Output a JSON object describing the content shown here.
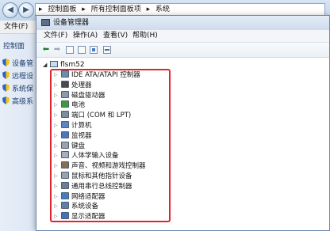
{
  "background_window": {
    "breadcrumb": [
      "控制面板",
      "所有控制面板项",
      "系统"
    ],
    "menu_file": "文件(F)",
    "left_home": "控制面",
    "left_items": [
      {
        "label": "设备管"
      },
      {
        "label": "远程设"
      },
      {
        "label": "系统保"
      },
      {
        "label": "高级系"
      }
    ]
  },
  "window": {
    "title": "设备管理器",
    "menu": {
      "file": "文件(F)",
      "action": "操作(A)",
      "view": "查看(V)",
      "help": "帮助(H)"
    }
  },
  "tree": {
    "root_name": "flsm52",
    "highlight_color": "#e0242c",
    "categories": [
      {
        "label": "IDE ATA/ATAPI 控制器",
        "icon": "ide-controller-icon",
        "color": "#6f8cab"
      },
      {
        "label": "处理器",
        "icon": "processor-icon",
        "color": "#4a4a4a"
      },
      {
        "label": "磁盘驱动器",
        "icon": "disk-drive-icon",
        "color": "#8f9aa6"
      },
      {
        "label": "电池",
        "icon": "battery-icon",
        "color": "#3d9b3a"
      },
      {
        "label": "端口 (COM 和 LPT)",
        "icon": "port-icon",
        "color": "#7f8c99"
      },
      {
        "label": "计算机",
        "icon": "computer-icon",
        "color": "#5a86c4"
      },
      {
        "label": "监视器",
        "icon": "monitor-icon",
        "color": "#4a78c0"
      },
      {
        "label": "键盘",
        "icon": "keyboard-icon",
        "color": "#9aa3ad"
      },
      {
        "label": "人体学输入设备",
        "icon": "hid-icon",
        "color": "#a8b1bb"
      },
      {
        "label": "声音、视频和游戏控制器",
        "icon": "sound-icon",
        "color": "#8a6f4f"
      },
      {
        "label": "鼠标和其他指针设备",
        "icon": "mouse-icon",
        "color": "#9aa3ad"
      },
      {
        "label": "通用串行总线控制器",
        "icon": "usb-icon",
        "color": "#6f7f90"
      },
      {
        "label": "网络适配器",
        "icon": "network-adapter-icon",
        "color": "#3f7fc8"
      },
      {
        "label": "系统设备",
        "icon": "system-device-icon",
        "color": "#5d7fa8"
      },
      {
        "label": "显示适配器",
        "icon": "display-adapter-icon",
        "color": "#4573b8"
      }
    ]
  }
}
